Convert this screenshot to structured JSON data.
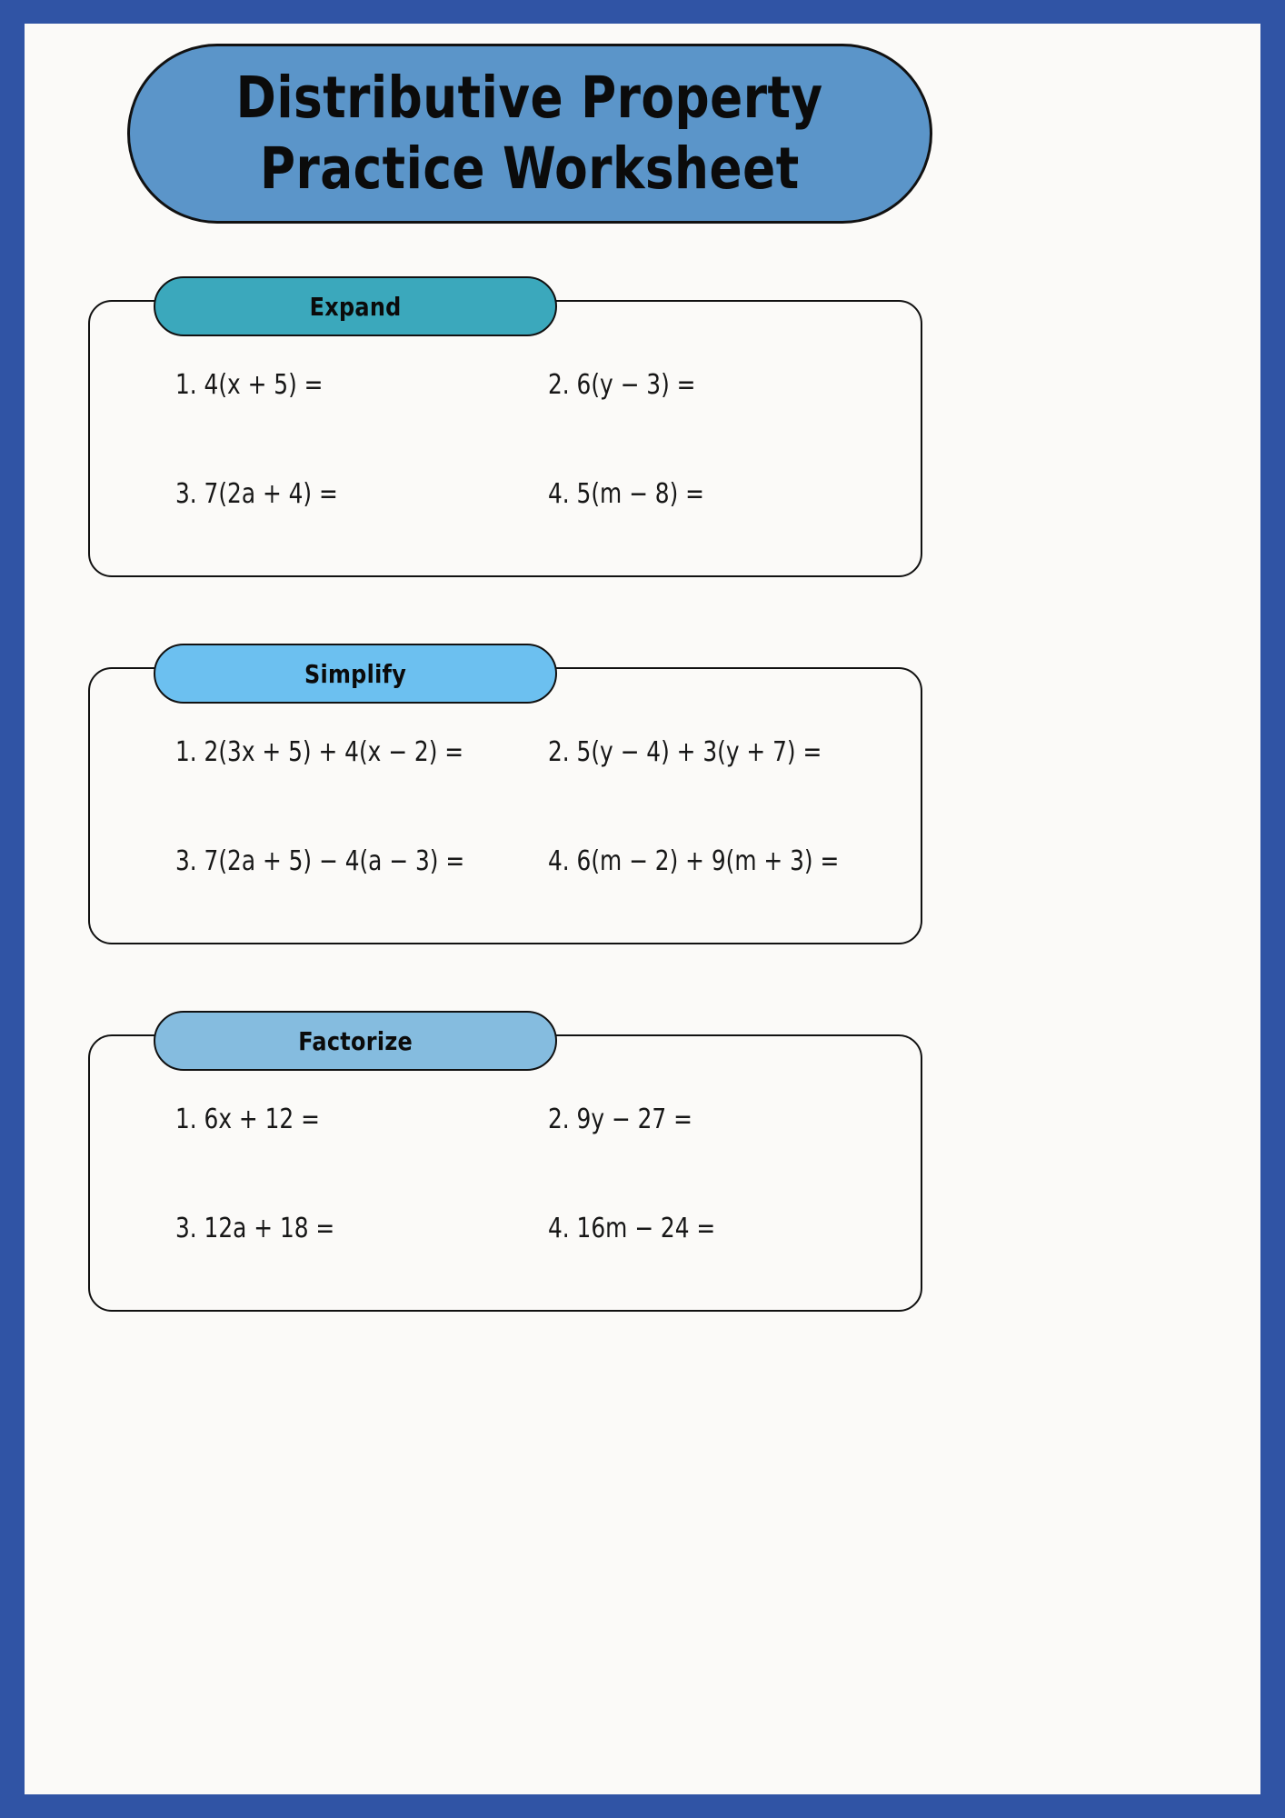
{
  "page": {
    "frame_color": "#3054a5",
    "sheet_color": "#fbfaf8"
  },
  "title": {
    "line1": "Distributive Property",
    "line2": "Practice Worksheet",
    "banner_color": "#5b95c9"
  },
  "sections": [
    {
      "id": "expand",
      "label": "Expand",
      "pill_color": "#3ba8bc",
      "problems": [
        "1. 4(x + 5) =",
        "2. 6(y − 3) =",
        "3. 7(2a + 4) =",
        "4. 5(m − 8) ="
      ]
    },
    {
      "id": "simplify",
      "label": "Simplify",
      "pill_color": "#6cc0f0",
      "problems": [
        "1. 2(3x + 5) + 4(x − 2) =",
        "2. 5(y − 4) + 3(y + 7) =",
        "3. 7(2a + 5) − 4(a − 3) =",
        "4. 6(m − 2) + 9(m + 3) ="
      ]
    },
    {
      "id": "factorize",
      "label": "Factorize",
      "pill_color": "#85bcdf",
      "problems": [
        "1. 6x + 12 =",
        "2. 9y − 27 =",
        "3. 12a + 18 =",
        "4. 16m − 24 ="
      ]
    }
  ]
}
